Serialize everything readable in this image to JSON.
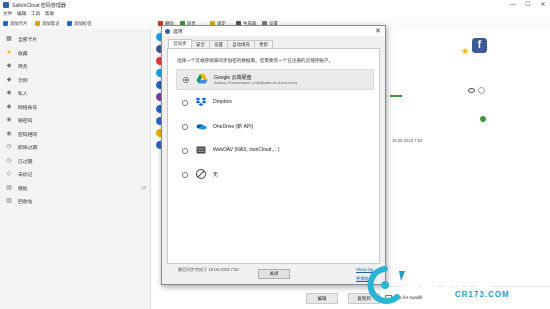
{
  "app": {
    "title": "SafeInCloud 密码管理器"
  },
  "window_controls": [
    "—",
    "☐",
    "✕"
  ],
  "menu": [
    "文件",
    "编辑",
    "工具",
    "帮助"
  ],
  "toolbar": [
    {
      "label": "添加卡片",
      "icon": "add-card-icon",
      "color": "#2a66c7"
    },
    {
      "label": "添加笔记",
      "icon": "add-note-icon",
      "color": "#d8a800"
    },
    {
      "label": "添加标签",
      "icon": "add-label-icon",
      "color": "#2a66c7"
    },
    {
      "label": "删除",
      "icon": "delete-icon",
      "color": "#c0392b"
    },
    {
      "label": "同步",
      "icon": "sync-icon",
      "color": "#3a8f3a"
    },
    {
      "label": "锁定",
      "icon": "lock-icon",
      "color": "#d8a800"
    },
    {
      "label": "生成器",
      "icon": "generator-icon",
      "color": "#555555"
    },
    {
      "label": "设置",
      "icon": "settings-icon",
      "color": "#777777"
    }
  ],
  "sidebar": {
    "items": [
      {
        "label": "全部卡片",
        "icon": "cards-icon",
        "glyph": "▦",
        "count": "",
        "icon_color": "#666666"
      },
      {
        "label": "收藏",
        "icon": "star-icon",
        "glyph": "★",
        "count": "",
        "icon_color": "#f0b400"
      },
      {
        "label": "商务",
        "icon": "tag-icon",
        "glyph": "◆",
        "count": "",
        "icon_color": "#777777"
      },
      {
        "label": "示例",
        "icon": "tag-icon",
        "glyph": "◆",
        "count": "",
        "icon_color": "#777777"
      },
      {
        "label": "私人",
        "icon": "tag-icon",
        "glyph": "◆",
        "count": "",
        "icon_color": "#777777"
      },
      {
        "label": "网络账号",
        "icon": "tag-icon",
        "glyph": "◆",
        "count": "",
        "icon_color": "#777777"
      },
      {
        "label": "弱密码",
        "icon": "weak-password-icon",
        "glyph": "◉",
        "count": "",
        "icon_color": "#777777"
      },
      {
        "label": "密码相同",
        "icon": "same-password-icon",
        "glyph": "◉",
        "count": "",
        "icon_color": "#777777"
      },
      {
        "label": "即将过期",
        "icon": "expiring-icon",
        "glyph": "◷",
        "count": "",
        "icon_color": "#777777"
      },
      {
        "label": "已过期",
        "icon": "expired-icon",
        "glyph": "◷",
        "count": "",
        "icon_color": "#777777"
      },
      {
        "label": "未标记",
        "icon": "unlabeled-icon",
        "glyph": "◇",
        "count": "",
        "icon_color": "#777777"
      },
      {
        "label": "模板",
        "icon": "template-icon",
        "glyph": "▤",
        "count": "13",
        "icon_color": "#777777"
      },
      {
        "label": "回收站",
        "icon": "trash-icon",
        "glyph": "▥",
        "count": "",
        "icon_color": "#777777"
      }
    ]
  },
  "card_icon_colors": [
    "#1da1f2",
    "#3b5998",
    "#e53935",
    "#1da1f2",
    "#2a66c7",
    "#7b3fa0",
    "#2a66c7",
    "#2a66c7",
    "#f0b400",
    "#2a66c7"
  ],
  "dialog": {
    "title": "选项",
    "close": "✕",
    "tabs": [
      "云同步",
      "安全",
      "设置",
      "自动填充",
      "更新"
    ],
    "hint": "选择一个云端存储来同步加密的数据库。您需要有一个已注册的云储存账户。",
    "options": [
      {
        "name": "Google 云端硬盘",
        "sub": "Andrey Shcherbakov (info@safe-in-cloud.com)",
        "selected": true,
        "icon": "google-drive-icon"
      },
      {
        "name": "Dropbox",
        "sub": "",
        "selected": false,
        "icon": "dropbox-icon"
      },
      {
        "name": "OneDrive (新 API)",
        "sub": "",
        "selected": false,
        "icon": "onedrive-icon"
      },
      {
        "name": "WebDAV (NAS, ownCloud,…)",
        "sub": "",
        "selected": false,
        "icon": "webdav-icon"
      },
      {
        "name": "无",
        "sub": "",
        "selected": false,
        "icon": "none-icon"
      }
    ],
    "last_sync": "最后同步完成于 16.06.2019 7:50",
    "show_log": "Show log",
    "change_account": "更换账号",
    "close_button": "关闭"
  },
  "detail": {
    "date": "16.06.2019 7:52",
    "edit": "编辑",
    "copy": "复制到",
    "autofill": "Use for Autofill"
  },
  "watermark": {
    "main": "西西软件园",
    "sub": "CR173.COM"
  }
}
